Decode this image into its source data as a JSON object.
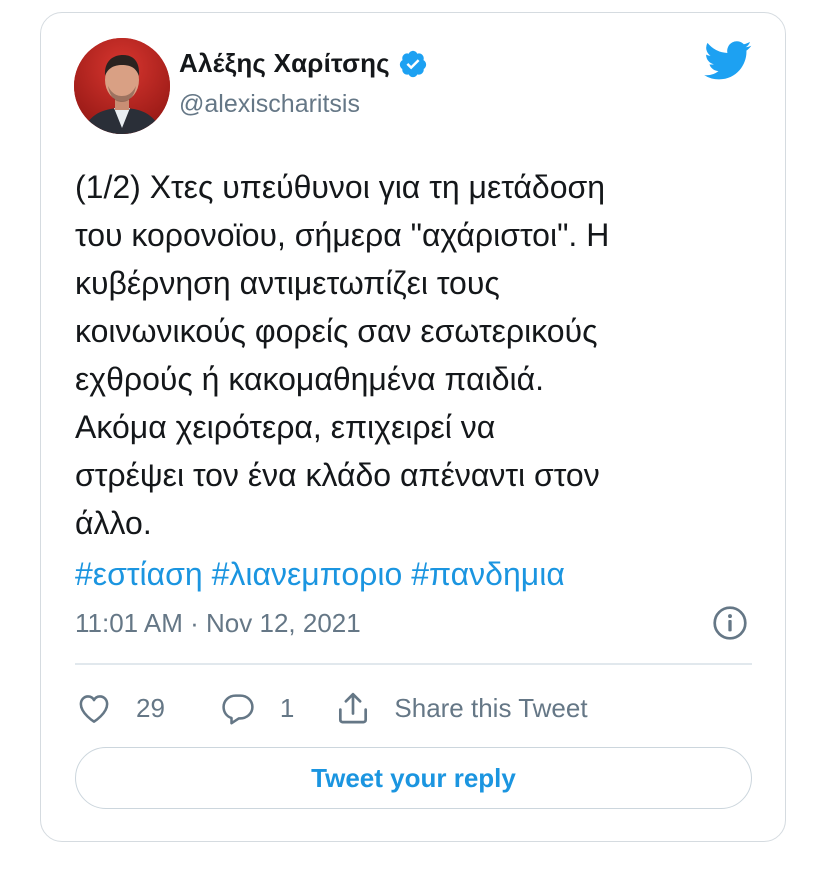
{
  "author": {
    "name": "Αλέξης Χαρίτσης",
    "handle": "@alexischaritsis",
    "verified": true,
    "avatar_icon": "profile-photo"
  },
  "tweet": {
    "text_lines": [
      "(1/2) Χτες υπεύθυνοι για τη μετάδοση",
      "του κορονοϊου, σήμερα \"αχάριστοι\". Η",
      "κυβέρνηση αντιμετωπίζει τους",
      "κοινωνικούς φορείς σαν εσωτερικούς",
      "εχθρούς ή κακομαθημένα παιδιά.",
      "Ακόμα χειρότερα, επιχειρεί να",
      "στρέψει τον ένα κλάδο απέναντι στον",
      "άλλο."
    ],
    "hashtags": [
      "#εστίαση",
      "#λιανεμποριο",
      "#πανδημια"
    ],
    "timestamp": "11:01 AM · Nov 12, 2021"
  },
  "actions": {
    "likes": "29",
    "replies": "1",
    "share_label": "Share this Tweet"
  },
  "reply_button_label": "Tweet your reply",
  "colors": {
    "accent": "#1da1f2",
    "link": "#1b95e0",
    "text": "#14171a",
    "muted": "#657786",
    "border": "#d5dbe0"
  },
  "icons": {
    "brand": "twitter-bird-icon",
    "verified": "verified-badge-icon",
    "info": "info-icon",
    "like": "heart-icon",
    "reply": "reply-bubble-icon",
    "share": "share-icon"
  }
}
